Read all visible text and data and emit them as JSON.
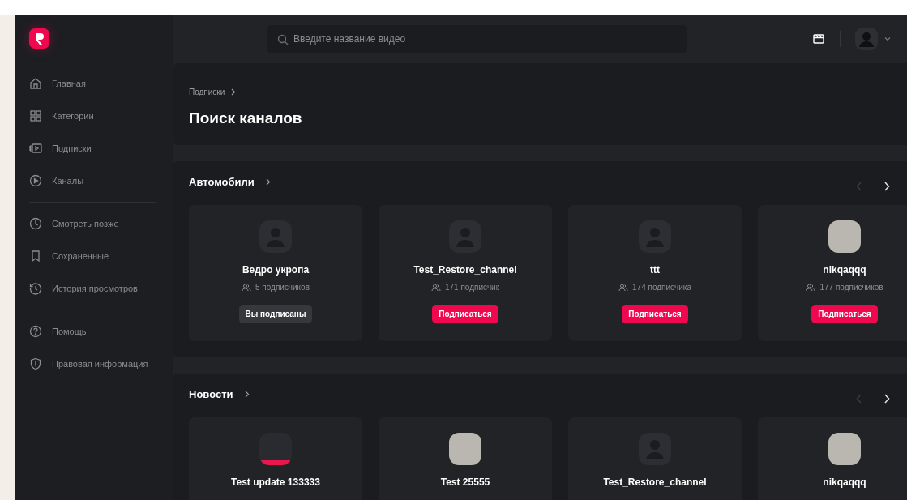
{
  "search": {
    "placeholder": "Введите название видео"
  },
  "sidebar": {
    "groups": [
      [
        {
          "label": "Главная",
          "selected": false
        },
        {
          "label": "Категории",
          "selected": false
        },
        {
          "label": "Подписки",
          "selected": false
        },
        {
          "label": "Каналы",
          "selected": false
        }
      ],
      [
        {
          "label": "Смотреть позже",
          "selected": false
        },
        {
          "label": "Сохраненные",
          "selected": false
        },
        {
          "label": "История просмотров",
          "selected": false
        }
      ],
      [
        {
          "label": "Помощь",
          "selected": false
        },
        {
          "label": "Правовая информация",
          "selected": false
        }
      ]
    ]
  },
  "breadcrumb": [
    "Подписки"
  ],
  "page_title": "Поиск каналов",
  "sections": [
    {
      "title": "Автомобили",
      "prev_disabled": true,
      "next_disabled": false,
      "channels": [
        {
          "kind": "default",
          "name": "Ведро укропа",
          "subscribers": "5 подписчиков",
          "subscribed": true,
          "button": "Вы подписаны"
        },
        {
          "kind": "default",
          "name": "Test_Restore_channel",
          "subscribers": "171 подписчик",
          "subscribed": false,
          "button": "Подписаться"
        },
        {
          "kind": "default",
          "name": "ttt",
          "subscribers": "174 подписчика",
          "subscribed": false,
          "button": "Подписаться"
        },
        {
          "kind": "photo",
          "name": "nikqaqqq",
          "subscribers": "177 подписчиков",
          "subscribed": false,
          "button": "Подписаться"
        }
      ]
    },
    {
      "title": "Новости",
      "prev_disabled": true,
      "next_disabled": false,
      "channels": [
        {
          "kind": "screenshot",
          "name": "Test update 133333"
        },
        {
          "kind": "photo",
          "name": "Test 25555"
        },
        {
          "kind": "default",
          "name": "Test_Restore_channel"
        },
        {
          "kind": "photo",
          "name": "nikqaqqq"
        }
      ]
    }
  ]
}
